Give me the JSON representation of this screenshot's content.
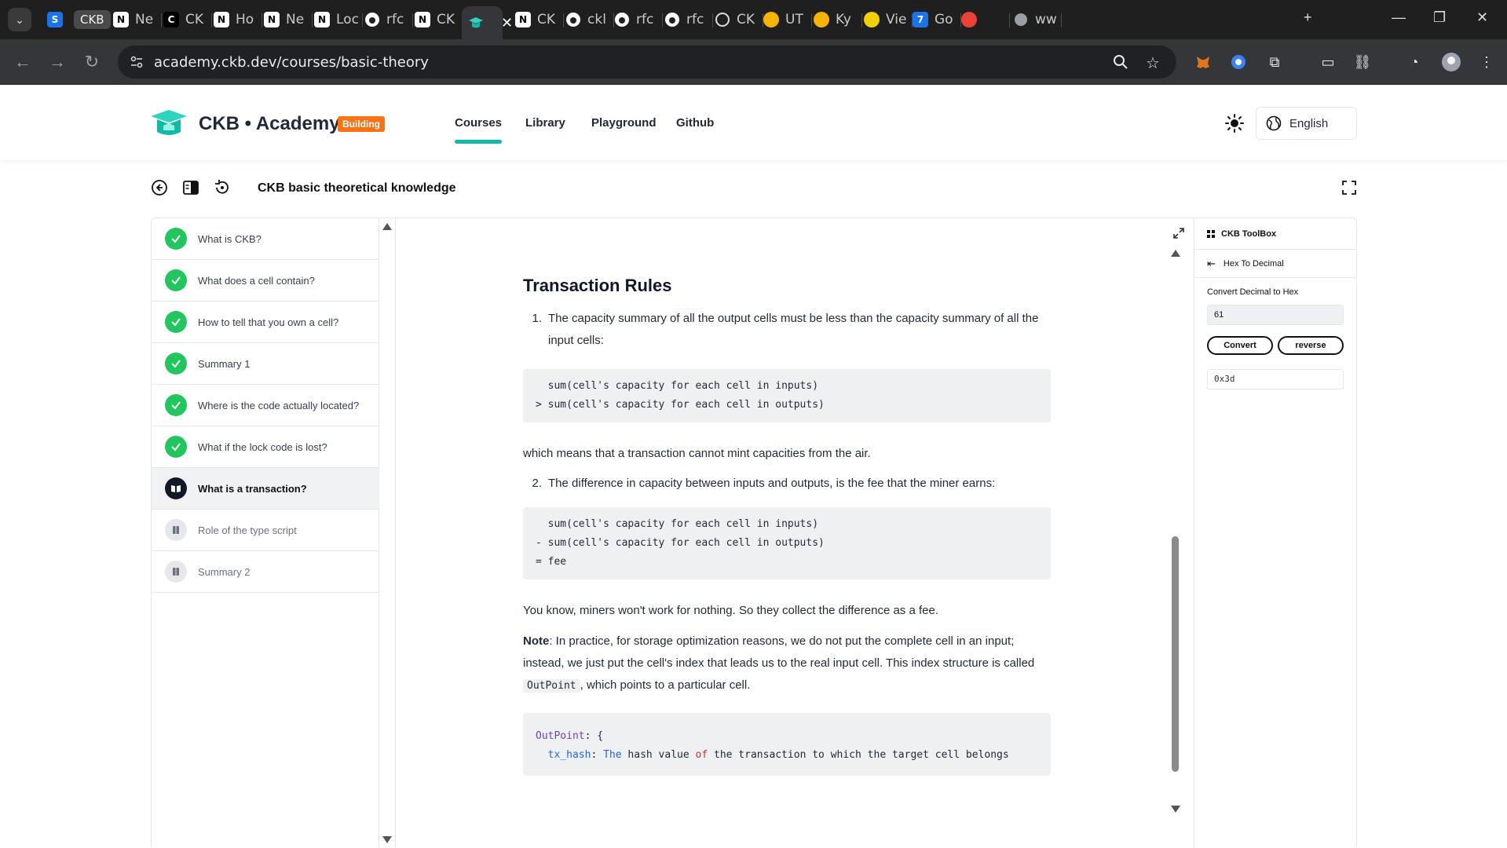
{
  "browser": {
    "tabs": [
      {
        "icon": "S",
        "label": "",
        "color": "#1a73e8"
      },
      {
        "icon": "",
        "label": "CKB",
        "color": ""
      },
      {
        "icon": "N",
        "label": "Ne",
        "color": "#000"
      },
      {
        "icon": "C",
        "label": "CK",
        "color": "#000"
      },
      {
        "icon": "N",
        "label": "Ho",
        "color": "#000"
      },
      {
        "icon": "N",
        "label": "Ne",
        "color": "#000"
      },
      {
        "icon": "N",
        "label": "Loc",
        "color": "#000"
      },
      {
        "icon": "gh",
        "label": "rfc",
        "color": ""
      },
      {
        "icon": "N",
        "label": "CK",
        "color": "#000"
      },
      {
        "icon": "cap",
        "label": "",
        "color": ""
      },
      {
        "icon": "N",
        "label": "CK",
        "color": "#000"
      },
      {
        "icon": "gh",
        "label": "ckl",
        "color": ""
      },
      {
        "icon": "gh",
        "label": "rfc",
        "color": ""
      },
      {
        "icon": "gh",
        "label": "rfc",
        "color": ""
      },
      {
        "icon": "ai",
        "label": "CK",
        "color": ""
      },
      {
        "icon": "",
        "label": "UT",
        "color": "#f5b400"
      },
      {
        "icon": "",
        "label": "Ky",
        "color": "#f5b400"
      },
      {
        "icon": "",
        "label": "Vie",
        "color": "#f5d000"
      },
      {
        "icon": "7",
        "label": "Go",
        "color": "#1a73e8"
      },
      {
        "icon": "",
        "label": "",
        "color": "#ea4335"
      },
      {
        "icon": "",
        "label": "ww",
        "color": ""
      }
    ],
    "url": "academy.ckb.dev/courses/basic-theory"
  },
  "site": {
    "brand": "CKB • Academy",
    "badge": "Building",
    "nav": [
      "Courses",
      "Library",
      "Playground",
      "Github"
    ],
    "language": "English",
    "accent": "#14b8a6"
  },
  "course": {
    "title": "CKB basic theoretical knowledge",
    "lessons": [
      {
        "label": "What is CKB?",
        "status": "done"
      },
      {
        "label": "What does a cell contain?",
        "status": "done"
      },
      {
        "label": "How to tell that you own a cell?",
        "status": "done"
      },
      {
        "label": "Summary 1",
        "status": "done"
      },
      {
        "label": "Where is the code actually located?",
        "status": "done"
      },
      {
        "label": "What if the lock code is lost?",
        "status": "done"
      },
      {
        "label": "What is a transaction?",
        "status": "current"
      },
      {
        "label": "Role of the type script",
        "status": "locked"
      },
      {
        "label": "Summary 2",
        "status": "locked"
      }
    ]
  },
  "doc": {
    "heading": "Transaction Rules",
    "item1_num": "1.",
    "item1": "The capacity summary of all the output cells must be less than the capacity summary of all the input cells:",
    "code1": "  sum(cell's capacity for each cell in inputs)\n> sum(cell's capacity for each cell in outputs)",
    "para1": "which means that a transaction cannot mint capacities from the air.",
    "item2_num": "2.",
    "item2": "The difference in capacity between inputs and outputs, is the fee that the miner earns:",
    "code2": "  sum(cell's capacity for each cell in inputs)\n- sum(cell's capacity for each cell in outputs)\n= fee",
    "para2": "You know, miners won't work for nothing. So they collect the difference as a fee.",
    "note_label": "Note",
    "note_text1": ": In practice, for storage optimization reasons, we do not put the complete cell in an input; instead, we just put the cell's index that leads us to the real input cell. This index structure is called ",
    "note_code": "OutPoint",
    "note_text2": ", which points to a particular cell.",
    "code3_line1_key": "OutPoint",
    "code3_line1_rest": ": {",
    "code3_line2_key": "tx_hash",
    "code3_line2_a": ": ",
    "code3_line2_the": "The",
    "code3_line2_b": " hash value ",
    "code3_line2_of": "of",
    "code3_line2_c": " the transaction to which the target cell belongs"
  },
  "toolbox": {
    "title": "CKB ToolBox",
    "tool": "Hex To Decimal",
    "label": "Convert Decimal to Hex",
    "input_value": "61",
    "convert": "Convert",
    "reverse": "reverse",
    "output": "0x3d"
  }
}
